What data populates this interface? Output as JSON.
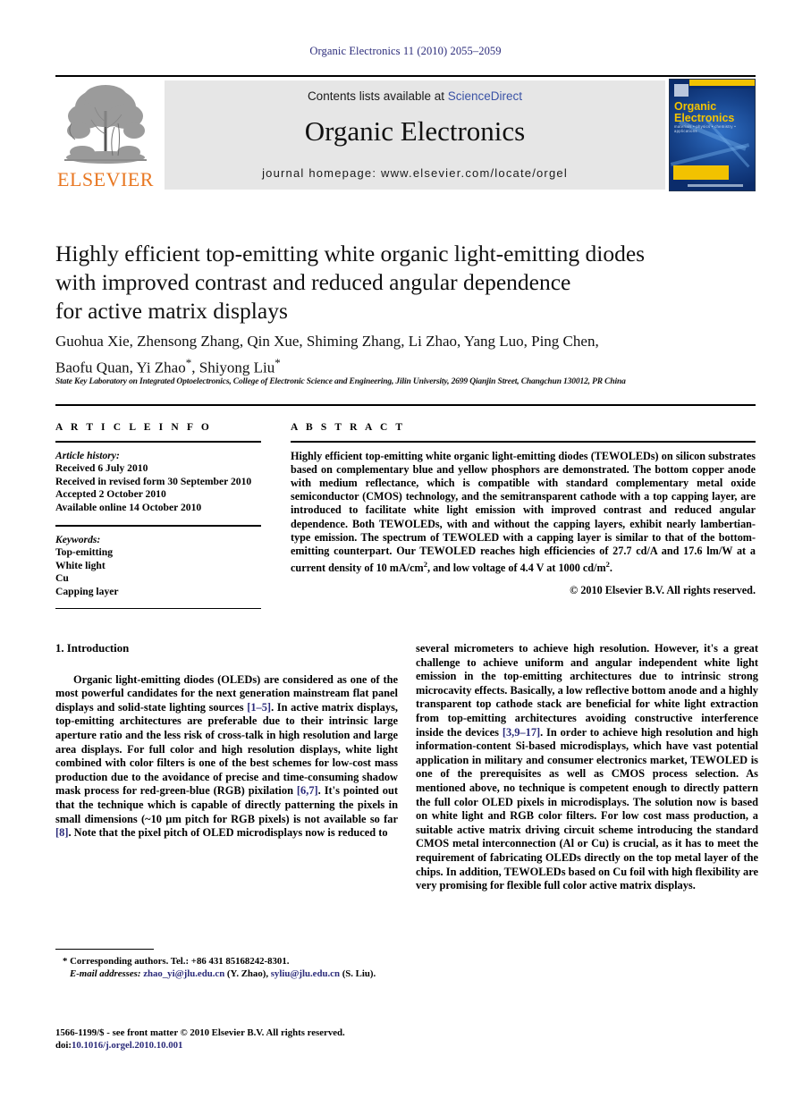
{
  "running_head": "Organic Electronics 11 (2010) 2055–2059",
  "masthead": {
    "publisher_name": "ELSEVIER",
    "contents_prefix": "Contents lists available at ",
    "contents_link": "ScienceDirect",
    "journal_title": "Organic Electronics",
    "homepage": "journal homepage: www.elsevier.com/locate/orgel",
    "cover": {
      "title_line1": "Organic",
      "title_line2": "Electronics",
      "subtitle": "materials • physics • chemistry • applications"
    }
  },
  "article": {
    "title": "Highly efficient top-emitting white organic light-emitting diodes with improved contrast and reduced angular dependence for active matrix displays",
    "title_lines": [
      "Highly efficient top-emitting white organic light-emitting diodes",
      "with improved contrast and reduced angular dependence",
      "for active matrix displays"
    ],
    "authors_line1": "Guohua Xie, Zhensong Zhang, Qin Xue, Shiming Zhang, Li Zhao, Yang Luo, Ping Chen,",
    "authors_line2_pre": "Baofu Quan, Yi Zhao",
    "authors_line2_mid": ", Shiyong Liu",
    "corresponding_marker": "*",
    "affiliation": "State Key Laboratory on Integrated Optoelectronics, College of Electronic Science and Engineering, Jilin University, 2699 Qianjin Street, Changchun 130012, PR China"
  },
  "article_info": {
    "heading": "A R T I C L E   I N F O",
    "history_label": "Article history:",
    "history": [
      "Received 6 July 2010",
      "Received in revised form 30 September 2010",
      "Accepted 2 October 2010",
      "Available online 14 October 2010"
    ],
    "keywords_label": "Keywords:",
    "keywords": [
      "Top-emitting",
      "White light",
      "Cu",
      "Capping layer"
    ]
  },
  "abstract": {
    "heading": "A B S T R A C T",
    "text_pre": "Highly efficient top-emitting white organic light-emitting diodes (TEWOLEDs) on silicon substrates based on complementary blue and yellow phosphors are demonstrated. The bottom copper anode with medium reflectance, which is compatible with standard complementary metal oxide semiconductor (CMOS) technology, and the semitransparent cathode with a top capping layer, are introduced to facilitate white light emission with improved contrast and reduced angular dependence. Both TEWOLEDs, with and without the capping layers, exhibit nearly lambertian-type emission. The spectrum of TEWOLED with a capping layer is similar to that of the bottom-emitting counterpart. Our TEWOLED reaches high efficiencies of 27.7 cd/A and 17.6 lm/W at a current density of 10 mA/cm",
    "sup1": "2",
    "text_mid": ", and low voltage of 4.4 V at 1000 cd/m",
    "sup2": "2",
    "text_end": ".",
    "copyright": "© 2010 Elsevier B.V. All rights reserved."
  },
  "introduction": {
    "section_title": "1. Introduction",
    "left_p1_a": "Organic light-emitting diodes (OLEDs) are considered as one of the most powerful candidates for the next generation mainstream flat panel displays and solid-state lighting sources ",
    "left_ref1": "[1–5]",
    "left_p1_b": ". In active matrix displays, top-emitting architectures are preferable due to their intrinsic large aperture ratio and the less risk of cross-talk in high resolution and large area displays. For full color and high resolution displays, white light combined with color filters is one of the best schemes for low-cost mass production due to the avoidance of precise and time-consuming shadow mask process for red-green-blue (RGB) pixilation ",
    "left_ref2": "[6,7]",
    "left_p1_c": ". It's pointed out that the technique which is capable of directly patterning the pixels in small dimensions (~10 µm pitch for RGB pixels) is not available so far ",
    "left_ref3": "[8]",
    "left_p1_d": ". Note that the pixel pitch of OLED microdisplays now is reduced to",
    "right_p_a": "several micrometers to achieve high resolution. However, it's a great challenge to achieve uniform and angular independent white light emission in the top-emitting architectures due to intrinsic strong microcavity effects. Basically, a low reflective bottom anode and a highly transparent top cathode stack are beneficial for white light extraction from top-emitting architectures avoiding constructive interference inside the devices ",
    "right_ref1": "[3,9–17]",
    "right_p_b": ". In order to achieve high resolution and high information-content Si-based microdisplays, which have vast potential application in military and consumer electronics market, TEWOLED is one of the prerequisites as well as CMOS process selection. As mentioned above, no technique is competent enough to directly pattern the full color OLED pixels in microdisplays. The solution now is based on white light and RGB color filters. For low cost mass production, a suitable active matrix driving circuit scheme introducing the standard CMOS metal interconnection (Al or Cu) is crucial, as it has to meet the requirement of fabricating OLEDs directly on the top metal layer of the chips. In addition, TEWOLEDs based on Cu foil with high flexibility are very promising for flexible full color active matrix displays."
  },
  "footnotes": {
    "corresponding_marker": "*",
    "corresponding": " Corresponding authors. Tel.: +86 431 85168242-8301.",
    "email_label": "E-mail addresses:",
    "email1": "zhao_yi@jlu.edu.cn",
    "email1_owner": "(Y. Zhao),",
    "email2": "syliu@jlu.edu.cn",
    "email2_owner": "(S. Liu).",
    "issn_line": "1566-1199/$ - see front matter © 2010 Elsevier B.V. All rights reserved.",
    "doi_label": "doi:",
    "doi_value": "10.1016/j.orgel.2010.10.001"
  },
  "colors": {
    "link": "#2b2b7a",
    "elsevier_orange": "#E87722",
    "band_gray": "#e6e6e6",
    "cover_blue": "#0b2c6b",
    "cover_yellow": "#f2c200"
  }
}
